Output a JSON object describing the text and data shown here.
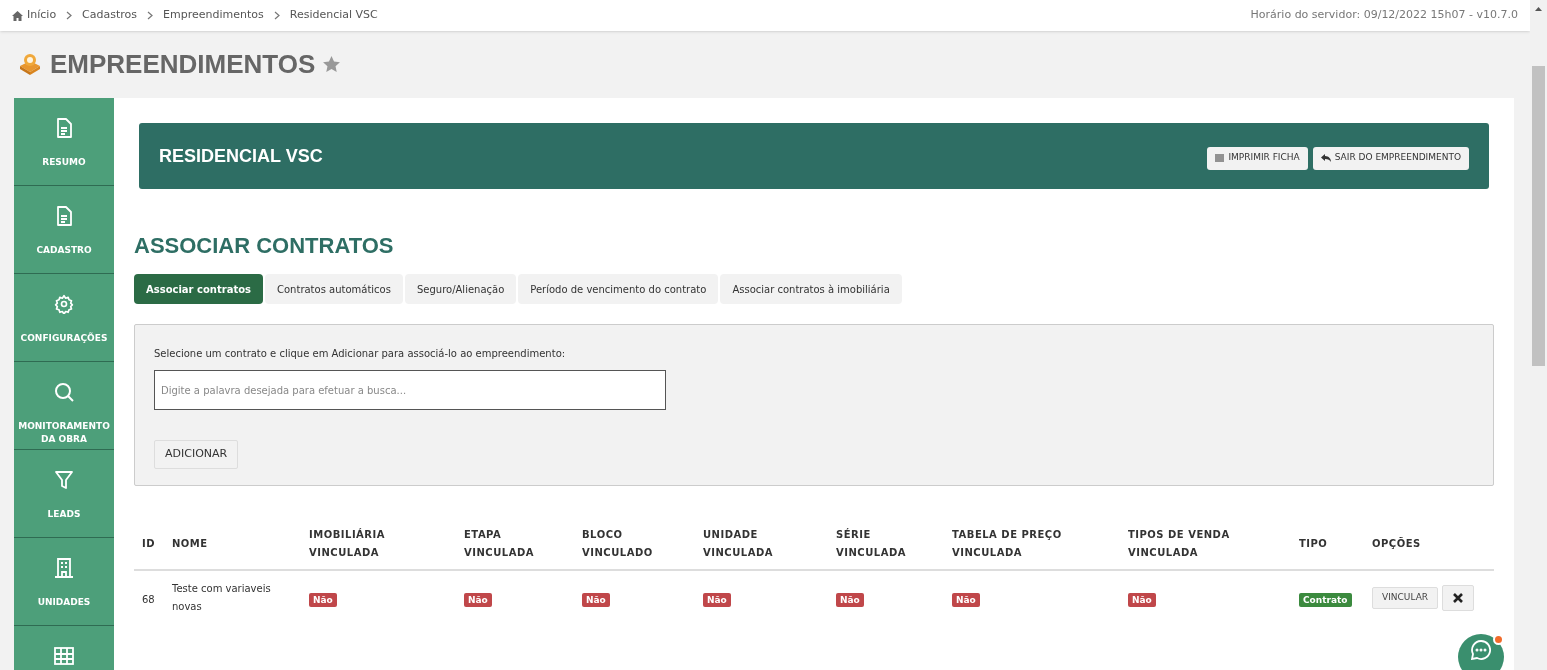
{
  "breadcrumb": [
    {
      "label": "Início"
    },
    {
      "label": "Cadastros"
    },
    {
      "label": "Empreendimentos"
    },
    {
      "label": "Residencial VSC"
    }
  ],
  "server_time": "Horário do servidor: 09/12/2022 15h07 - v10.7.0",
  "page_title": "EMPREENDIMENTOS",
  "sidebar": {
    "items": [
      {
        "kind": "labeled",
        "label": "RESUMO"
      },
      {
        "kind": "labeled",
        "label": "CADASTRO"
      },
      {
        "kind": "labeled",
        "label": "CONFIGURAÇÕES"
      },
      {
        "kind": "labeled",
        "label": "MONITORAMENTO DA OBRA"
      },
      {
        "kind": "labeled",
        "label": "LEADS"
      },
      {
        "kind": "labeled",
        "label": "UNIDADES"
      },
      {
        "kind": "icon_only"
      }
    ]
  },
  "header": {
    "title": "RESIDENCIAL VSC",
    "buttons": [
      "IMPRIMIR FICHA",
      "SAIR DO EMPREENDIMENTO"
    ]
  },
  "section_title": "ASSOCIAR CONTRATOS",
  "tabs": [
    {
      "label": "Associar contratos",
      "selected": true
    },
    {
      "label": "Contratos automáticos",
      "selected": false
    },
    {
      "label": "Seguro/Alienação",
      "selected": false
    },
    {
      "label": "Período de vencimento do contrato",
      "selected": false
    },
    {
      "label": "Associar contratos à imobiliária",
      "selected": false
    }
  ],
  "form": {
    "instruction": "Selecione um contrato e clique em Adicionar para associá-lo ao empreendimento:",
    "search": {
      "placeholder": "Digite a palavra desejada para efetuar a busca..."
    },
    "button": "ADICIONAR"
  },
  "table": {
    "columns": [
      "ID",
      "NOME",
      "IMOBILIÁRIA VINCULADA",
      "ETAPA VINCULADA",
      "BLOCO VINCULADO",
      "UNIDADE VINCULADA",
      "SÉRIE VINCULADA",
      "TABELA DE PREÇO VINCULADA",
      "TIPOS DE VENDA VINCULADA",
      "TIPO",
      "OPÇÕES"
    ],
    "rows": [
      {
        "id": "68",
        "name": "Teste com variaveis novas",
        "badges": [
          {
            "text": "Não",
            "color": "#c0474a"
          },
          {
            "text": "Não",
            "color": "#c0474a"
          },
          {
            "text": "Não",
            "color": "#c0474a"
          },
          {
            "text": "Não",
            "color": "#c0474a"
          },
          {
            "text": "Não",
            "color": "#c0474a"
          },
          {
            "text": "Não",
            "color": "#c0474a"
          },
          {
            "text": "Não",
            "color": "#c0474a"
          },
          {
            "text": "Contrato",
            "color": "#3b8a3e"
          }
        ],
        "action": "VINCULAR"
      }
    ]
  }
}
